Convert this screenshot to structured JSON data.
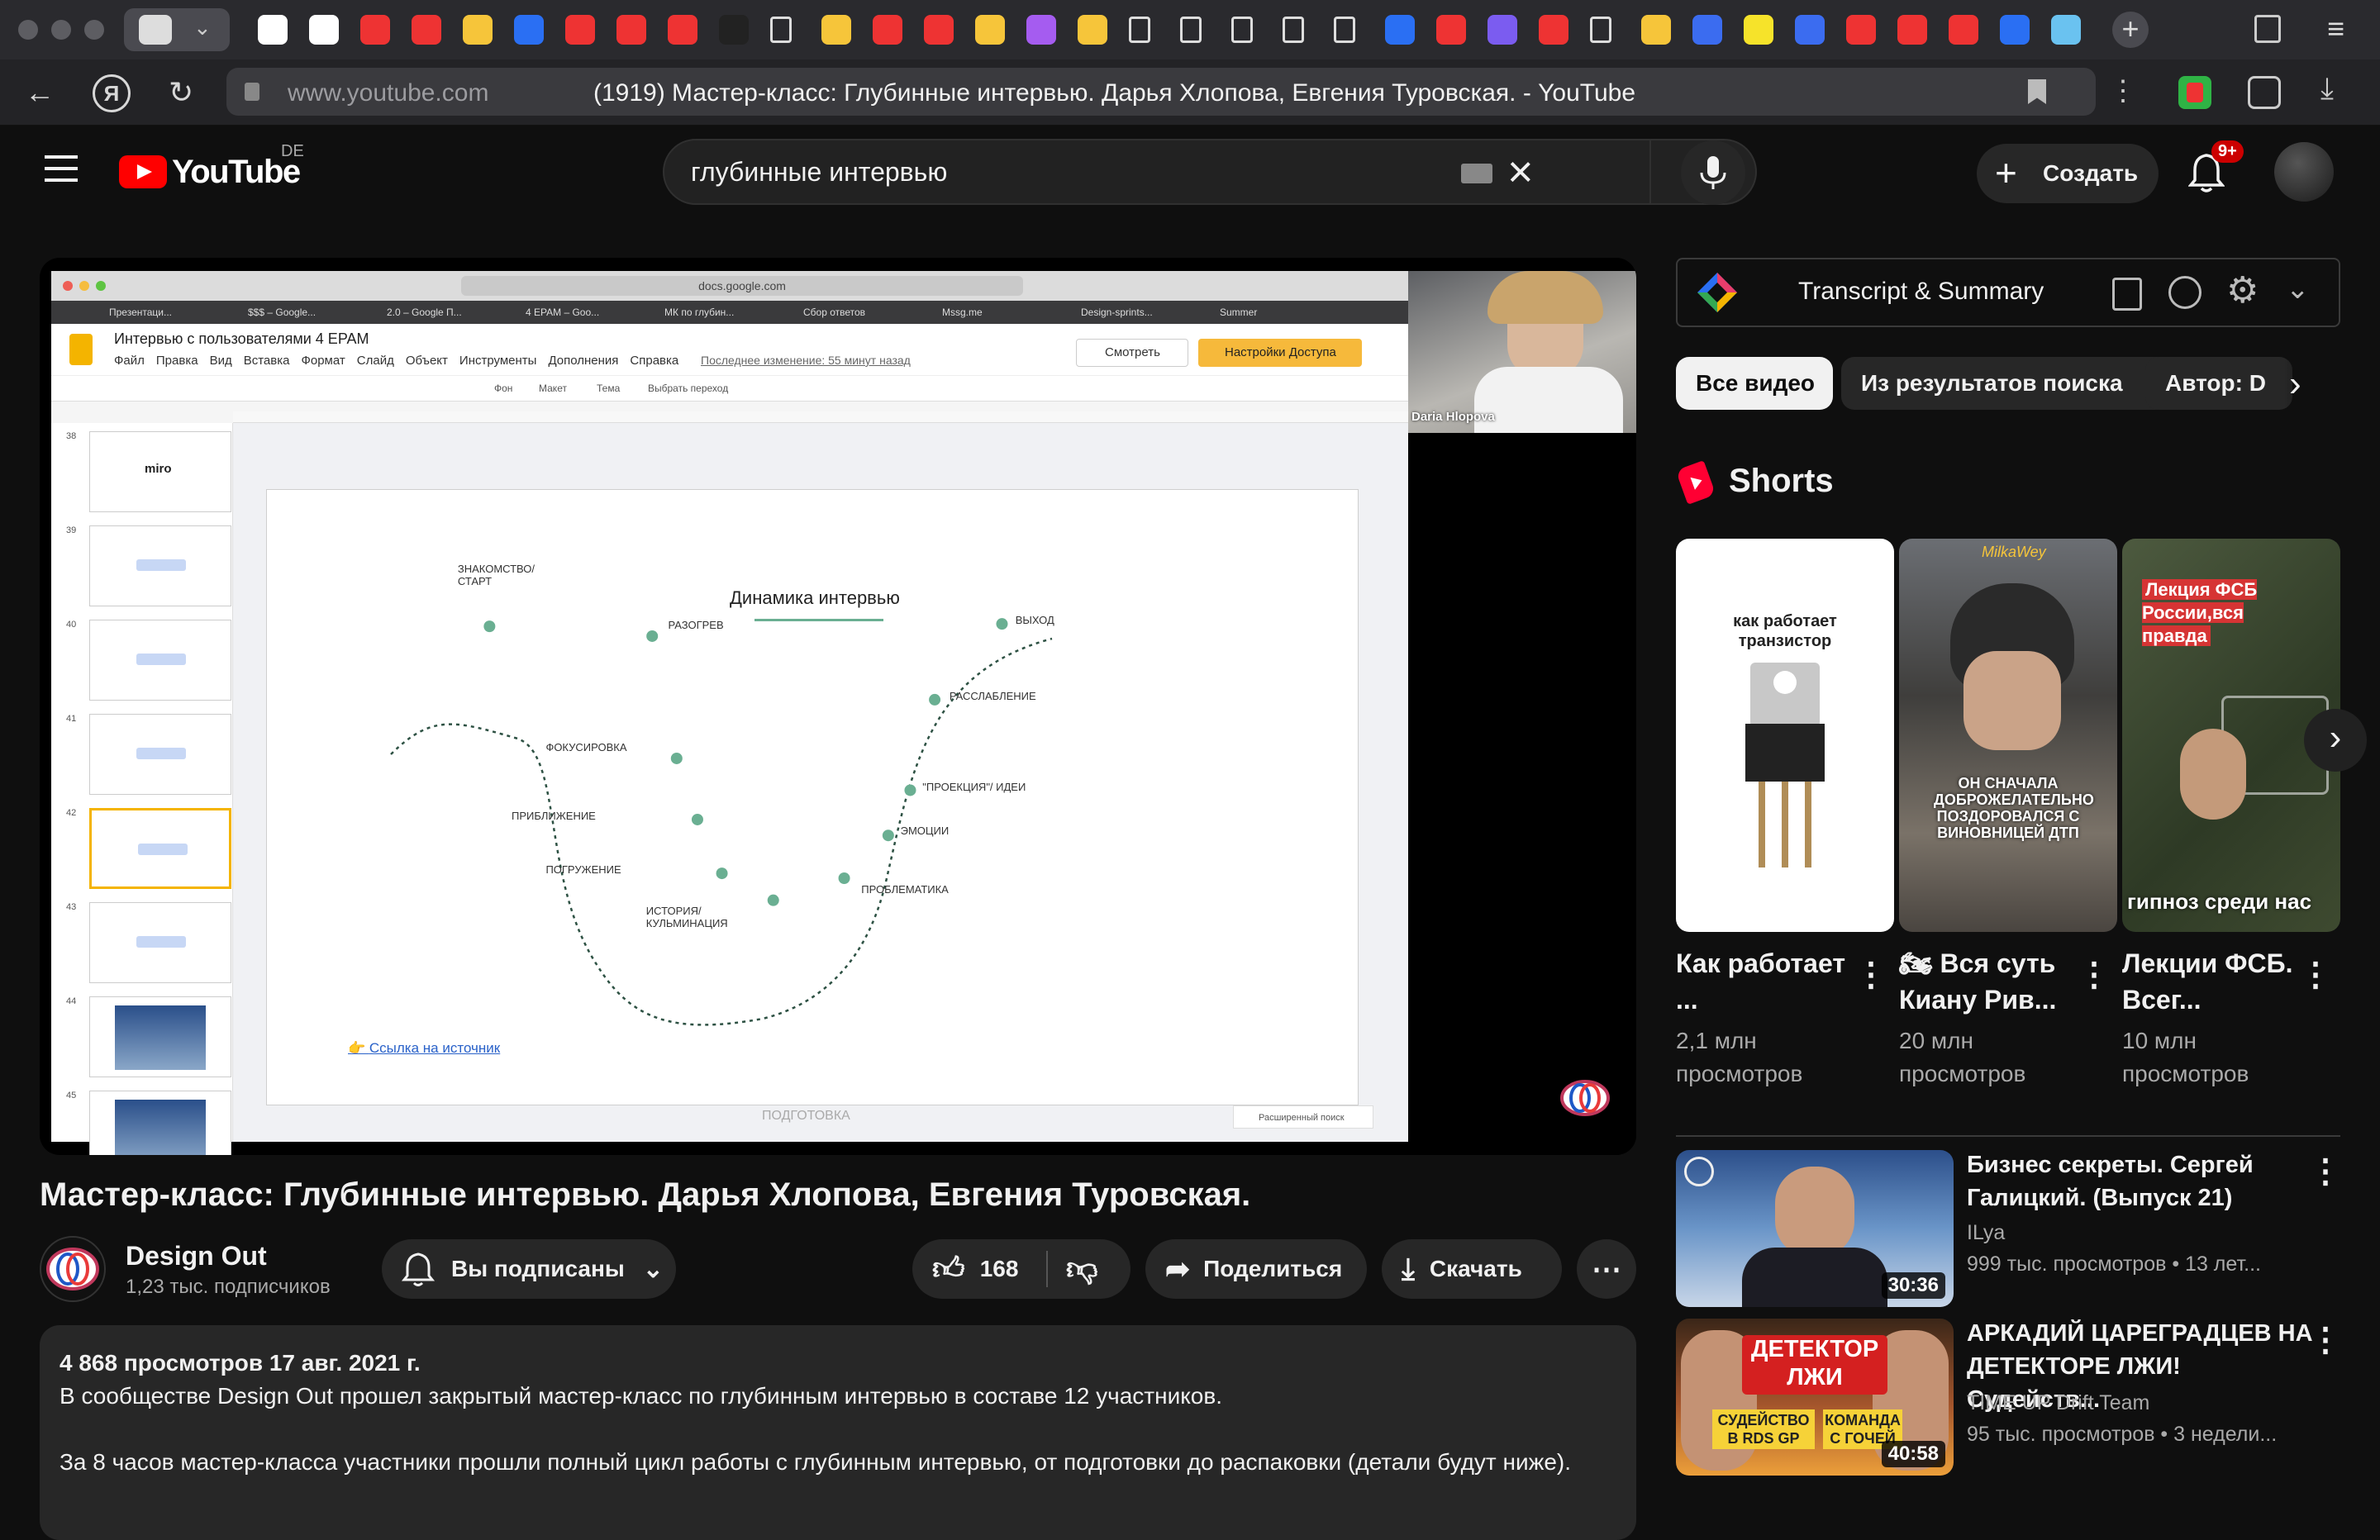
{
  "browser": {
    "url": "www.youtube.com",
    "page_title": "(1919) Мастер-класс: Глубинные интервью. Дарья Хлопова, Евгения Туровская. - YouTube"
  },
  "youtube": {
    "logo_text": "YouTube",
    "region": "DE",
    "search_value": "глубинные интервью",
    "create_label": "Создать",
    "notification_count": "9+"
  },
  "player": {
    "slides_doc_title": "Интервью с пользователями 4 EPAM",
    "slides_url": "docs.google.com",
    "slides_menu": [
      "Файл",
      "Правка",
      "Вид",
      "Вставка",
      "Формат",
      "Слайд",
      "Объект",
      "Инструменты",
      "Дополнения",
      "Справка"
    ],
    "last_change": "Последнее изменение: 55 минут назад",
    "view_btn": "Смотреть",
    "access_btn": "Настройки Доступа",
    "toolbar_items": [
      "Фон",
      "Макет",
      "Тема",
      "Выбрать переход"
    ],
    "bookmarks": [
      "Презентаци...",
      "$$$ – Google...",
      "2.0 – Google П...",
      "4 EPAM – Goo...",
      "МК по глубин...",
      "Сбор ответов",
      "Mssg.me",
      "Design-sprints...",
      "Summer"
    ],
    "thumb_numbers": [
      "38",
      "39",
      "40",
      "41",
      "42",
      "43",
      "44",
      "45"
    ],
    "thumb_miro": "miro",
    "slide_title": "Динамика интервью",
    "slide_stages": [
      {
        "label": "ЗНАКОМСТВО/\nСТАРТ"
      },
      {
        "label": "РАЗОГРЕВ"
      },
      {
        "label": "ФОКУСИРОВКА"
      },
      {
        "label": "ПРИБЛИЖЕНИЕ"
      },
      {
        "label": "ПОГРУЖЕНИЕ"
      },
      {
        "label": "ИСТОРИЯ/\nКУЛЬМИНАЦИЯ"
      },
      {
        "label": "ПРОБЛЕМАТИКА"
      },
      {
        "label": "ЭМОЦИИ"
      },
      {
        "label": "\"ПРОЕКЦИЯ\"/ ИДЕИ"
      },
      {
        "label": "РАССЛАБЛЕНИЕ"
      },
      {
        "label": "ВЫХОД"
      }
    ],
    "slide_link": "Ссылка на источник",
    "slide_notes": "ПОДГОТОВКА",
    "explore": "Расширенный поиск",
    "camera_name": "Daria Hlopova"
  },
  "video": {
    "title": "Мастер-класс: Глубинные интервью. Дарья Хлопова, Евгения Туровская.",
    "channel": "Design Out",
    "subscribers": "1,23 тыс. подписчиков",
    "subscribed_label": "Вы подписаны",
    "likes": "168",
    "share_label": "Поделиться",
    "download_label": "Скачать",
    "views_date": "4 868 просмотров  17 авг. 2021 г.",
    "desc_line1": "В сообществе Design Out прошел закрытый мастер-класс по глубинным интервью в составе 12 участников.",
    "desc_line2": "За 8 часов мастер-класса участники прошли полный цикл работы с глубинным интервью, от подготовки до распаковки (детали будут ниже)."
  },
  "sidebar": {
    "transcript_label": "Transcript & Summary",
    "chips": [
      "Все видео",
      "Из результатов поиска",
      "Автор: D"
    ],
    "shorts_label": "Shorts",
    "shorts": [
      {
        "title": "Как работает ...",
        "views": "2,1 млн просмотров",
        "thumb_text": "как работает транзистор"
      },
      {
        "title": "🏍 Вся суть Киану Рив...",
        "views": "20 млн просмотров",
        "thumb_text": "ОН СНАЧАЛА ДОБРОЖЕЛАТЕЛЬНО ПОЗДОРОВАЛСЯ С ВИНОВНИЦЕЙ ДТП",
        "thumb_tag": "МilkaWey"
      },
      {
        "title": "Лекции ФСБ. Всег...",
        "views": "10 млн просмотров",
        "thumb_text": "гипноз среди нас",
        "thumb_tag": "Лекция ФСБ России,вся правда"
      }
    ],
    "videos": [
      {
        "title": "Бизнес секреты. Сергей Галицкий. (Выпуск 21)",
        "channel": "ILya",
        "meta": "999 тыс. просмотров  • 13 лет...",
        "duration": "30:36"
      },
      {
        "title": "АРКАДИЙ ЦАРЕГРАДЦЕВ НА ДЕТЕКТОРЕ ЛЖИ! Судейств...",
        "channel": "TIME UP Drift Team",
        "meta": "95 тыс. просмотров  • 3 недели...",
        "duration": "40:58",
        "thumb_text": "ДЕТЕКТОР ЛЖИ",
        "thumb_sub1": "СУДЕЙСТВО В RDS GP",
        "thumb_sub2": "КОМАНДА С ГОЧЕЙ"
      }
    ]
  },
  "colors": {
    "yt_red": "#ff0000",
    "slide_accent": "#6aaf92",
    "access_btn": "#f6b93b"
  }
}
